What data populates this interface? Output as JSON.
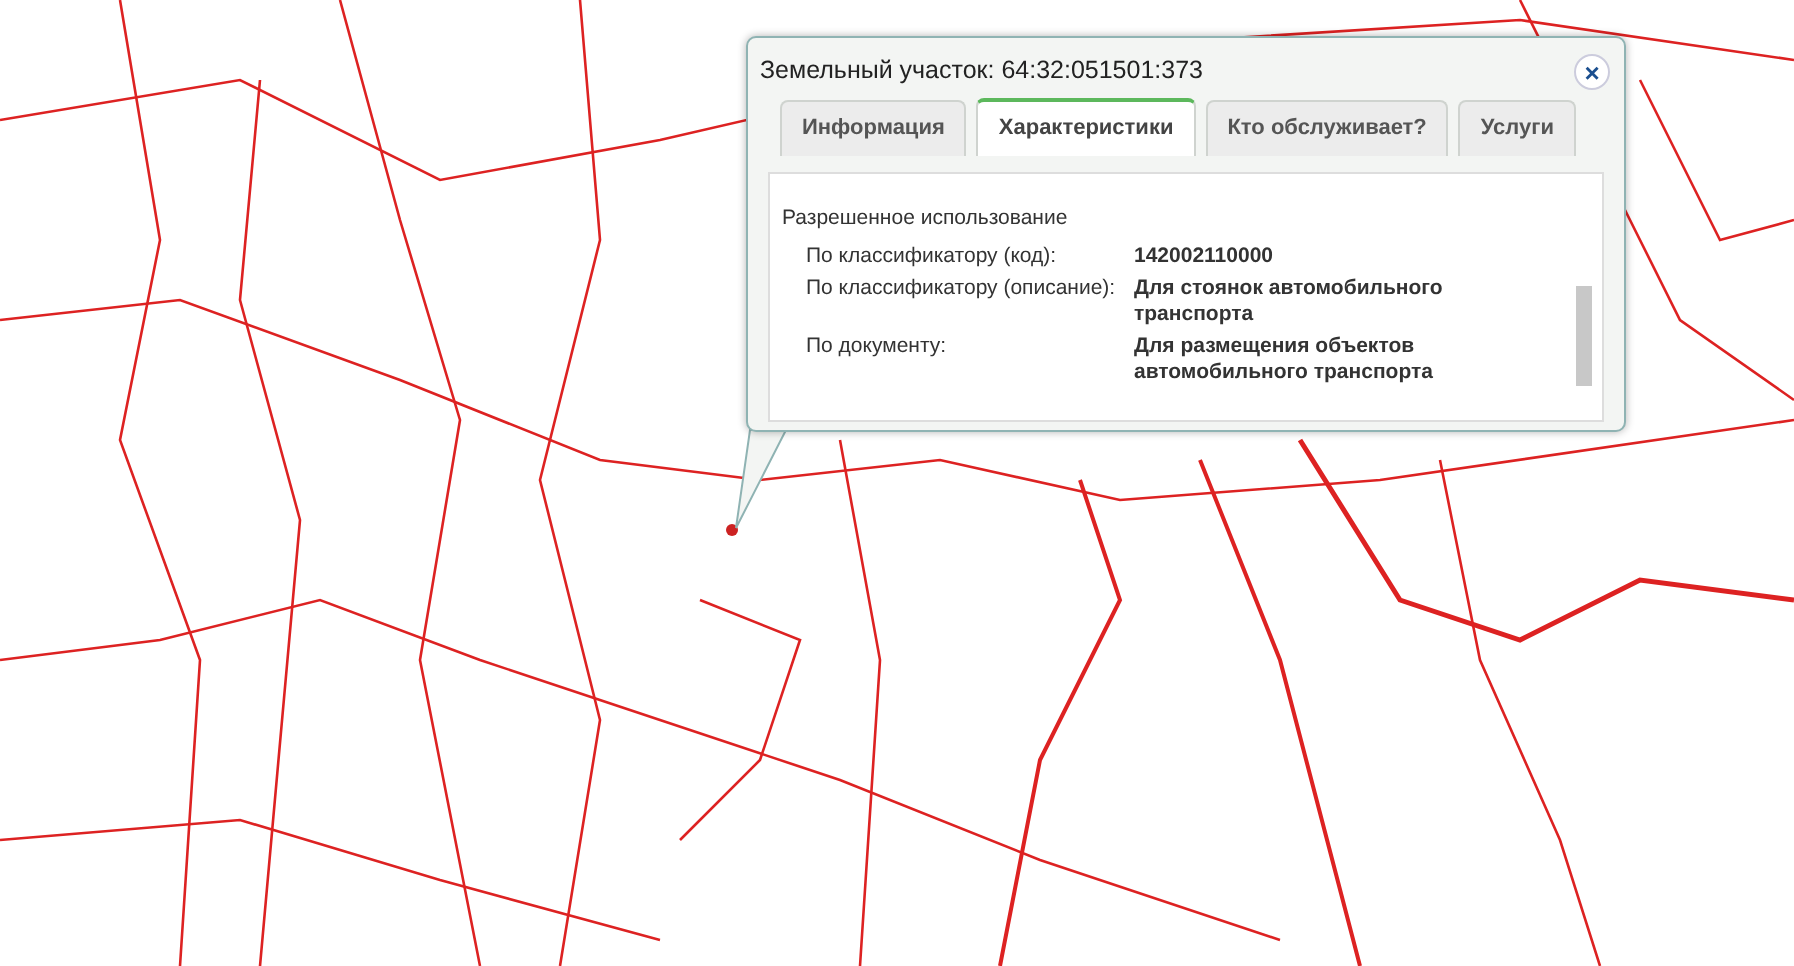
{
  "popup": {
    "title": "Земельный участок: 64:32:051501:373",
    "close_glyph": "×",
    "tabs": [
      {
        "label": "Информация",
        "selected": false
      },
      {
        "label": "Характеристики",
        "selected": true
      },
      {
        "label": "Кто обслуживает?",
        "selected": false
      },
      {
        "label": "Услуги",
        "selected": false
      }
    ],
    "section_title": "Разрешенное использование",
    "fields": [
      {
        "label": "По классификатору (код):",
        "value": "142002110000"
      },
      {
        "label": "По классификатору (описание):",
        "value": "Для стоянок автомобильного транспорта"
      },
      {
        "label": "По документу:",
        "value": "Для размещения объектов автомобильного транспорта"
      }
    ]
  }
}
